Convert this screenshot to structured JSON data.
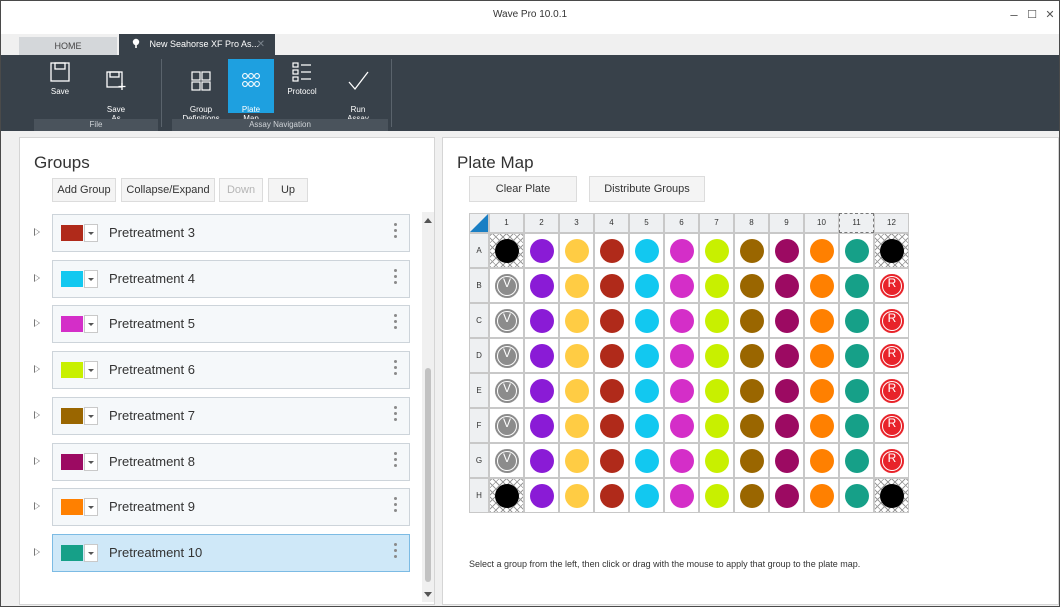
{
  "window": {
    "title": "Wave Pro 10.0.1",
    "minimize": "–",
    "maximize": "☐",
    "close": "✕"
  },
  "tabs": [
    {
      "label": "HOME"
    },
    {
      "label": "New Seahorse XF Pro As...",
      "close": "✕"
    }
  ],
  "ribbon": {
    "file_group": "File",
    "nav_group": "Assay Navigation",
    "buttons": [
      {
        "label": "Save",
        "icon": "save-icon"
      },
      {
        "label": "Save\nAs",
        "icon": "save-as-icon"
      },
      {
        "label": "Group\nDefinitions",
        "icon": "group-definitions-icon"
      },
      {
        "label": "Plate\nMap",
        "icon": "plate-map-icon",
        "active": true
      },
      {
        "label": "Protocol",
        "icon": "protocol-icon"
      },
      {
        "label": "Run\nAssay",
        "icon": "checkmark-icon"
      }
    ]
  },
  "groups_panel": {
    "title": "Groups",
    "buttons": {
      "add": "Add Group",
      "collapse": "Collapse/Expand",
      "down": "Down",
      "up": "Up"
    },
    "groups": [
      {
        "name": "Pretreatment 3",
        "color": "#b02a1a"
      },
      {
        "name": "Pretreatment 4",
        "color": "#12c8f0"
      },
      {
        "name": "Pretreatment 5",
        "color": "#d42ec8"
      },
      {
        "name": "Pretreatment 6",
        "color": "#c8f000"
      },
      {
        "name": "Pretreatment 7",
        "color": "#9a6600"
      },
      {
        "name": "Pretreatment 8",
        "color": "#9c0a62"
      },
      {
        "name": "Pretreatment 9",
        "color": "#ff8000"
      },
      {
        "name": "Pretreatment 10",
        "color": "#16a088",
        "selected": true
      }
    ]
  },
  "plate_panel": {
    "title": "Plate Map",
    "buttons": {
      "clear": "Clear Plate",
      "distribute": "Distribute Groups"
    },
    "columns": [
      "1",
      "2",
      "3",
      "4",
      "5",
      "6",
      "7",
      "8",
      "9",
      "10",
      "11",
      "12"
    ],
    "rows": [
      "A",
      "B",
      "C",
      "D",
      "E",
      "F",
      "G",
      "H"
    ],
    "column_colors": [
      "#000000",
      "#8a1bd6",
      "#ffcc44",
      "#b02a1a",
      "#12c8f0",
      "#d42ec8",
      "#c8f000",
      "#9a6600",
      "#9c0a62",
      "#ff8000",
      "#16a088",
      "#000000"
    ],
    "background_symbol": "V",
    "reference_symbol": "R",
    "hint": "Select a group from the left, then click or drag with the mouse to apply that group to the plate map."
  }
}
